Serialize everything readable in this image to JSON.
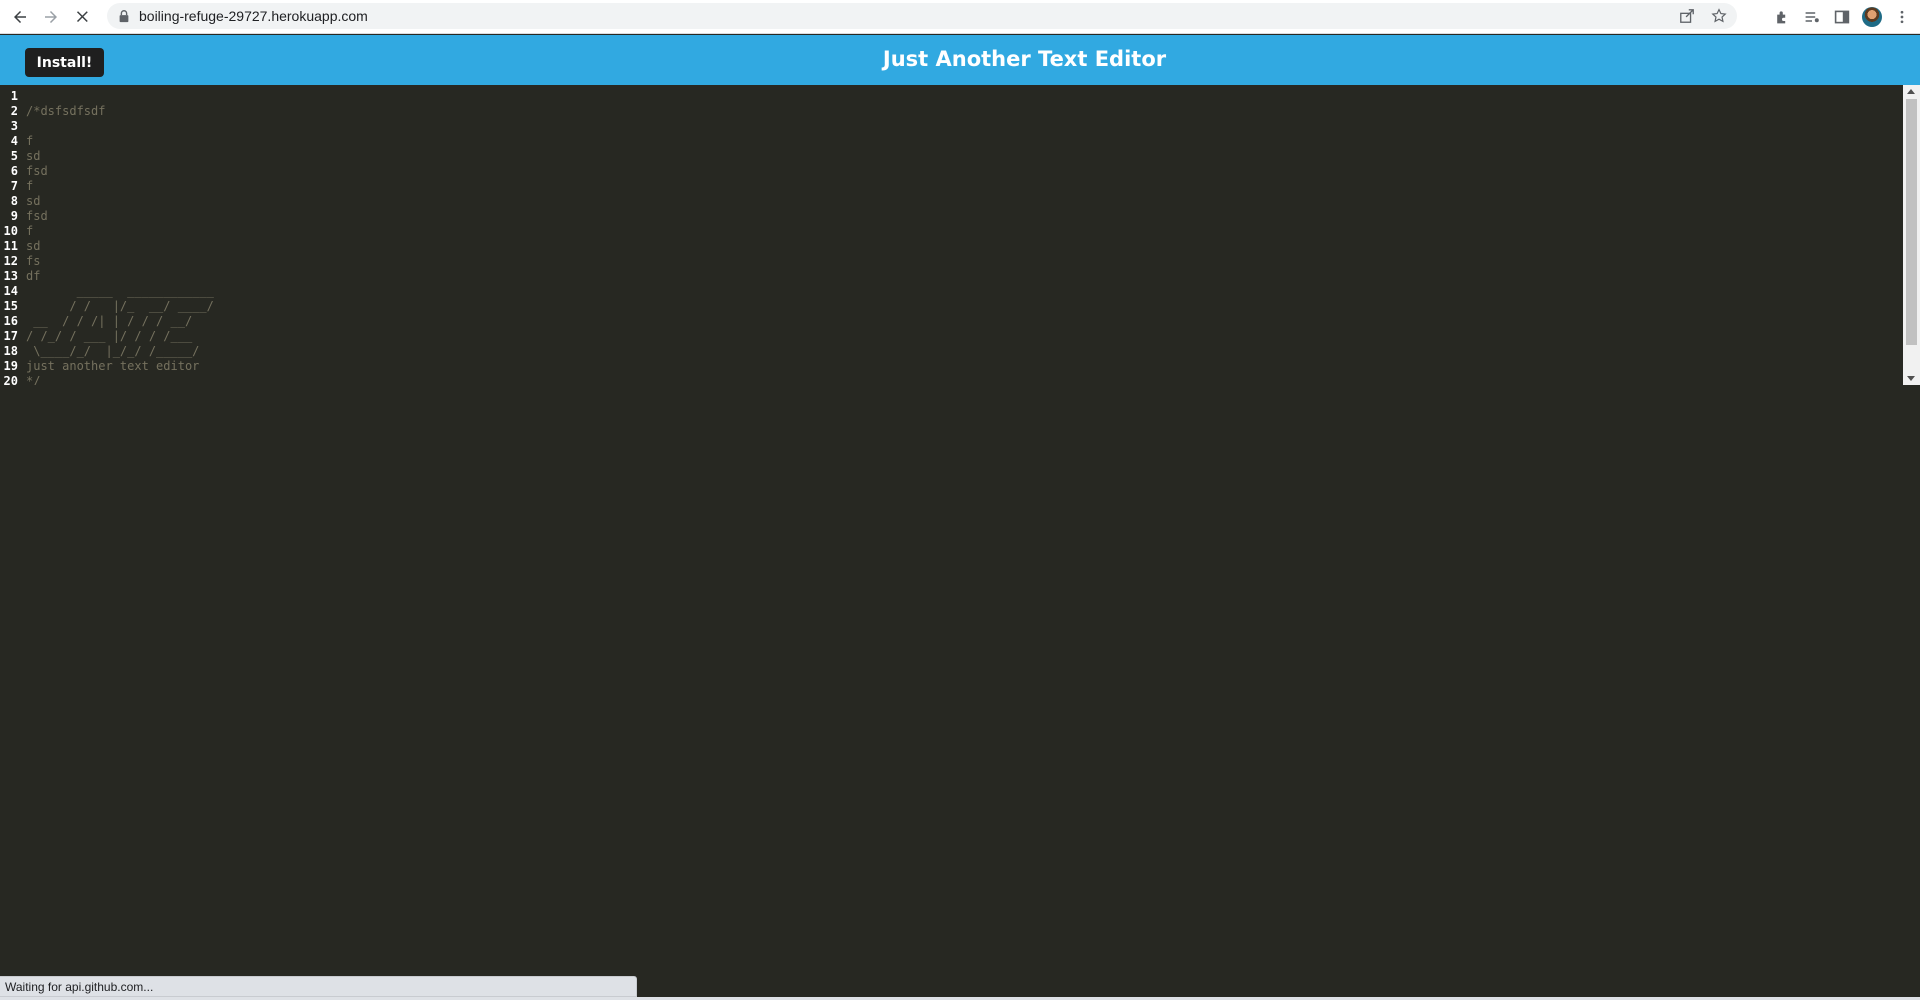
{
  "browser": {
    "url": "boiling-refuge-29727.herokuapp.com",
    "status_text": "Waiting for api.github.com..."
  },
  "app": {
    "install_label": "Install!",
    "title": "Just Another Text Editor"
  },
  "editor": {
    "lines": [
      {
        "n": "1",
        "text": ""
      },
      {
        "n": "2",
        "text": "/*dsfsdfsdf"
      },
      {
        "n": "3",
        "text": ""
      },
      {
        "n": "4",
        "text": "f"
      },
      {
        "n": "5",
        "text": "sd"
      },
      {
        "n": "6",
        "text": "fsd"
      },
      {
        "n": "7",
        "text": "f"
      },
      {
        "n": "8",
        "text": "sd"
      },
      {
        "n": "9",
        "text": "fsd"
      },
      {
        "n": "10",
        "text": "f"
      },
      {
        "n": "11",
        "text": "sd"
      },
      {
        "n": "12",
        "text": "fs"
      },
      {
        "n": "13",
        "text": "df"
      },
      {
        "n": "14",
        "text": "       _____  ____________"
      },
      {
        "n": "15",
        "text": "      / /   |/_  __/ ____/"
      },
      {
        "n": "16",
        "text": " __  / / /| | / / / __/"
      },
      {
        "n": "17",
        "text": "/ /_/ / ___ |/ / / /___"
      },
      {
        "n": "18",
        "text": " \\____/_/  |_/_/ /_____/"
      },
      {
        "n": "19",
        "text": "just another text editor"
      },
      {
        "n": "20",
        "text": "*/"
      }
    ]
  },
  "colors": {
    "header_bg": "#31a9e1",
    "editor_bg": "#272822",
    "comment": "#75715e",
    "line_number": "#ffffff"
  }
}
